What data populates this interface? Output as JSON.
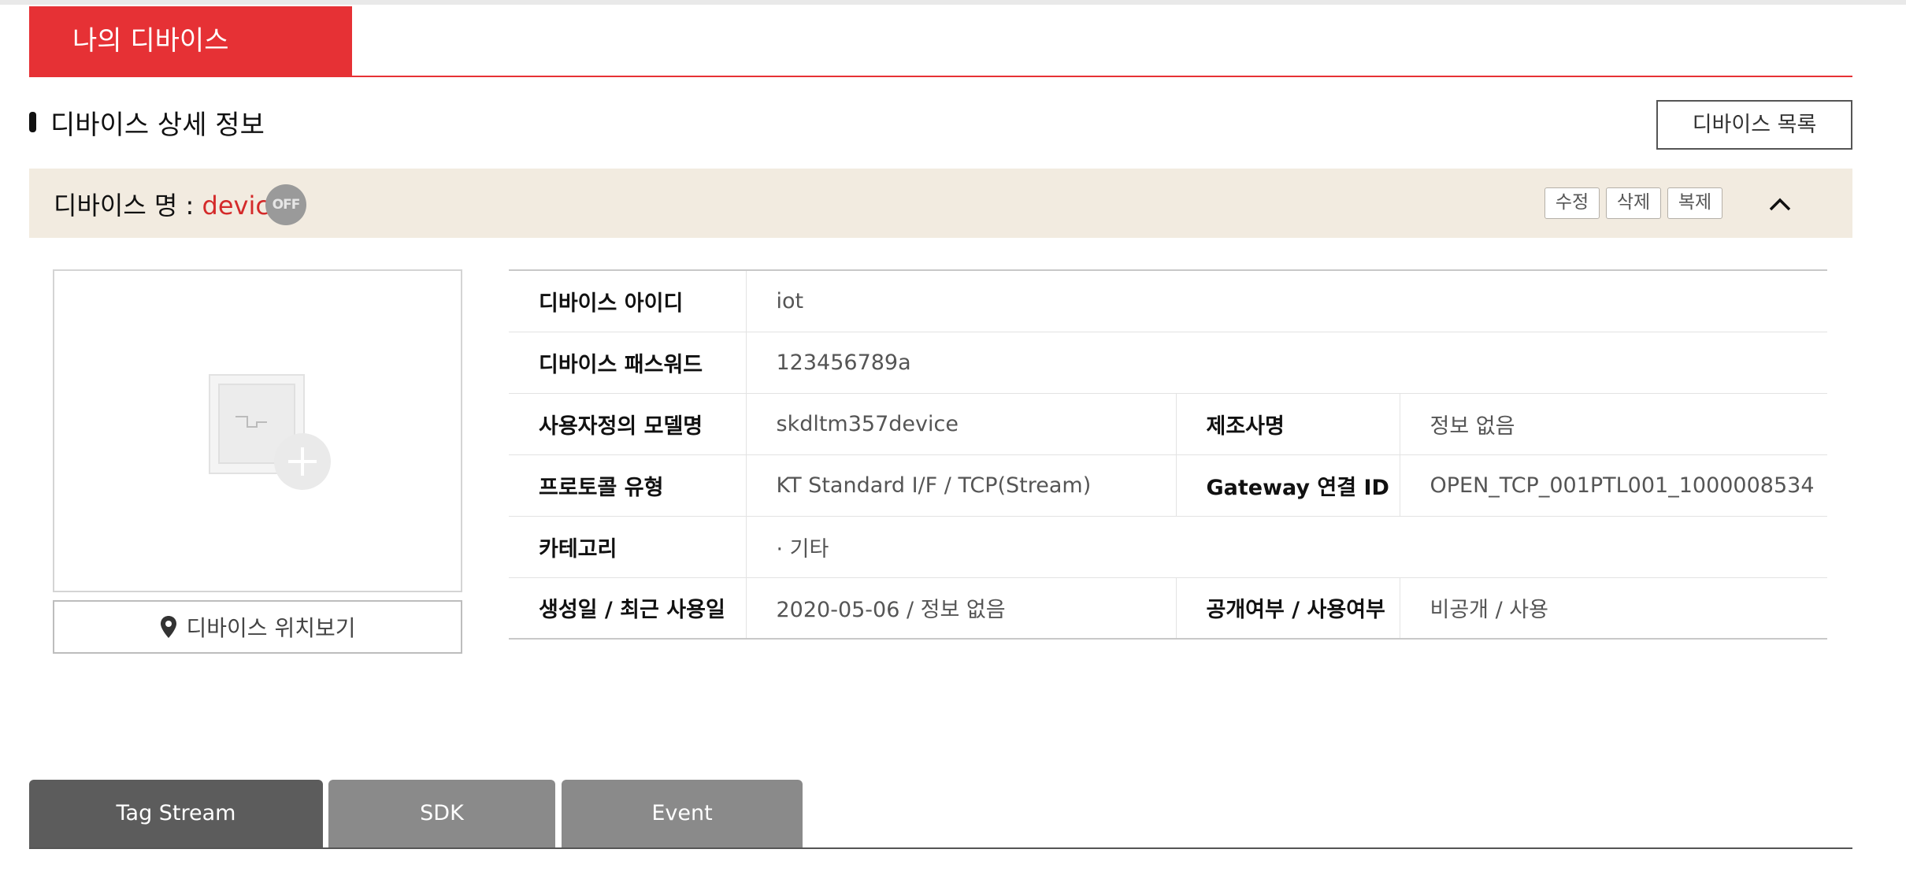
{
  "header": {
    "tab_label": "나의 디바이스"
  },
  "section": {
    "title": "디바이스 상세 정보",
    "list_button": "디바이스 목록"
  },
  "device": {
    "name_label": "디바이스 명 : ",
    "name_value": "device",
    "status_badge": "OFF",
    "actions": {
      "edit": "수정",
      "delete": "삭제",
      "copy": "복제"
    }
  },
  "image": {
    "location_button": "디바이스 위치보기"
  },
  "info": {
    "device_id_label": "디바이스 아이디",
    "device_id": "iot",
    "password_label": "디바이스 패스워드",
    "password": "123456789a",
    "model_label": "사용자정의 모델명",
    "model": "skdltm357device",
    "maker_label": "제조사명",
    "maker": "정보 없음",
    "protocol_label": "프로토콜 유형",
    "protocol": "KT Standard I/F / TCP(Stream)",
    "gateway_label": "Gateway 연결 ID",
    "gateway": "OPEN_TCP_001PTL001_1000008534",
    "category_label": "카테고리",
    "category": "· 기타",
    "dates_label": "생성일 / 최근 사용일",
    "dates": "2020-05-06 / 정보 없음",
    "visibility_label": "공개여부 / 사용여부",
    "visibility": "비공개 / 사용"
  },
  "tabs": [
    {
      "label": "Tag Stream",
      "active": true
    },
    {
      "label": "SDK",
      "active": false
    },
    {
      "label": "Event",
      "active": false
    }
  ],
  "colors": {
    "accent": "#e63135",
    "name_bar_bg": "#f2ebe0",
    "tab_active": "#5c5c5c",
    "tab_inactive": "#8a8a8a"
  },
  "icons": {
    "location": "map-pin-icon",
    "collapse": "chevron-up-icon",
    "image_placeholder": "image-add-icon"
  }
}
